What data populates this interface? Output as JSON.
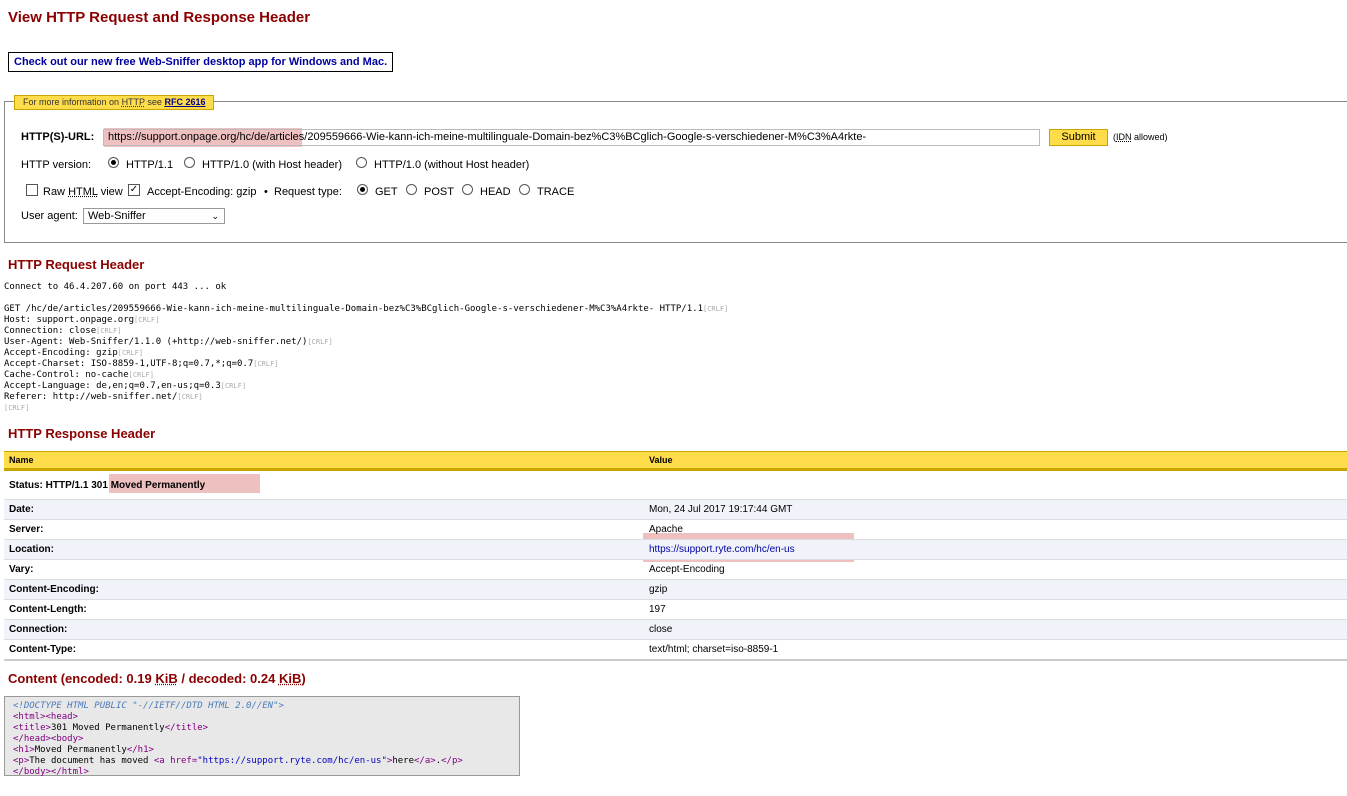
{
  "page": {
    "title": "View HTTP Request and Response Header",
    "promo_link": "Check out our new free Web-Sniffer desktop app for Windows and Mac."
  },
  "form": {
    "legend_prefix": "For more information on",
    "legend_http": "HTTP",
    "legend_see": "see",
    "legend_rfc": "RFC 2616",
    "url_label": "HTTP(S)-URL:",
    "url_value": "https://support.onpage.org/hc/de/articles/209559666-Wie-kann-ich-meine-multilinguale-Domain-bez%C3%BCglich-Google-s-verschiedener-M%C3%A4rkte-",
    "submit_label": "Submit",
    "idn_note_open": "(",
    "idn_abbr": "IDN",
    "idn_note_rest": "allowed)",
    "version_label": "HTTP version:",
    "versions": [
      "HTTP/1.1",
      "HTTP/1.0 (with Host header)",
      "HTTP/1.0 (without Host header)"
    ],
    "version_selected": "HTTP/1.1",
    "raw_html_label_pre": "Raw",
    "raw_html_abbr": "HTML",
    "raw_html_label_post": "view",
    "raw_html_checked": false,
    "accept_encoding_label": "Accept-Encoding: gzip",
    "accept_encoding_checked": true,
    "bullet": "•",
    "request_type_label": "Request type:",
    "request_types": [
      "GET",
      "POST",
      "HEAD",
      "TRACE"
    ],
    "request_type_selected": "GET",
    "user_agent_label": "User agent:",
    "user_agent_value": "Web-Sniffer"
  },
  "request": {
    "heading": "HTTP Request Header",
    "connect_line": "Connect to 46.4.207.60 on port 443 ... ok",
    "crlf": "[CRLF]",
    "lines": [
      "GET /hc/de/articles/209559666-Wie-kann-ich-meine-multilinguale-Domain-bez%C3%BCglich-Google-s-verschiedener-M%C3%A4rkte- HTTP/1.1",
      "Host: support.onpage.org",
      "Connection: close",
      "User-Agent: Web-Sniffer/1.1.0 (+http://web-sniffer.net/)",
      "Accept-Encoding: gzip",
      "Accept-Charset: ISO-8859-1,UTF-8;q=0.7,*;q=0.7",
      "Cache-Control: no-cache",
      "Accept-Language: de,en;q=0.7,en-us;q=0.3",
      "Referer: http://web-sniffer.net/",
      ""
    ]
  },
  "response": {
    "heading": "HTTP Response Header",
    "col_name": "Name",
    "col_value": "Value",
    "status_label": "Status: HTTP/1.1",
    "status_value": "301 Moved Permanently",
    "rows": [
      {
        "name": "Date:",
        "value": "Mon, 24 Jul 2017 19:17:44 GMT"
      },
      {
        "name": "Server:",
        "value": "Apache"
      },
      {
        "name": "Location:",
        "value": "https://support.ryte.com/hc/en-us"
      },
      {
        "name": "Vary:",
        "value": "Accept-Encoding"
      },
      {
        "name": "Content-Encoding:",
        "value": "gzip"
      },
      {
        "name": "Content-Length:",
        "value": "197"
      },
      {
        "name": "Connection:",
        "value": "close"
      },
      {
        "name": "Content-Type:",
        "value": "text/html; charset=iso-8859-1"
      }
    ]
  },
  "content": {
    "heading_pre": "Content (encoded: 0.19",
    "heading_unit1": "KiB",
    "heading_mid": "/ decoded: 0.24",
    "heading_unit2": "KiB",
    "heading_post": ")",
    "code": {
      "doctype": "<!DOCTYPE HTML PUBLIC \"-//IETF//DTD HTML 2.0//EN\">",
      "l2_tags": "<html><head>",
      "l3_open": "<title>",
      "l3_text": "301 Moved Permanently",
      "l3_close": "</title>",
      "l4_tags": "</head><body>",
      "l5_open": "<h1>",
      "l5_text": "Moved Permanently",
      "l5_close": "</h1>",
      "l6_open": "<p>",
      "l6_text": "The document has moved ",
      "l6_a_open": "<a href=",
      "l6_href": "\"https://support.ryte.com/hc/en-us\"",
      "l6_a_close_bracket": ">",
      "l6_link_text": "here",
      "l6_a_end": "</a>",
      "l6_dot": ".",
      "l6_p_end": "</p>",
      "l7_tags": "</body></html>"
    }
  },
  "colors": {
    "heading": "#8b0000",
    "accent_yellow": "#ffdc4a",
    "highlight": "#e28c8c",
    "link": "#0000a0"
  }
}
